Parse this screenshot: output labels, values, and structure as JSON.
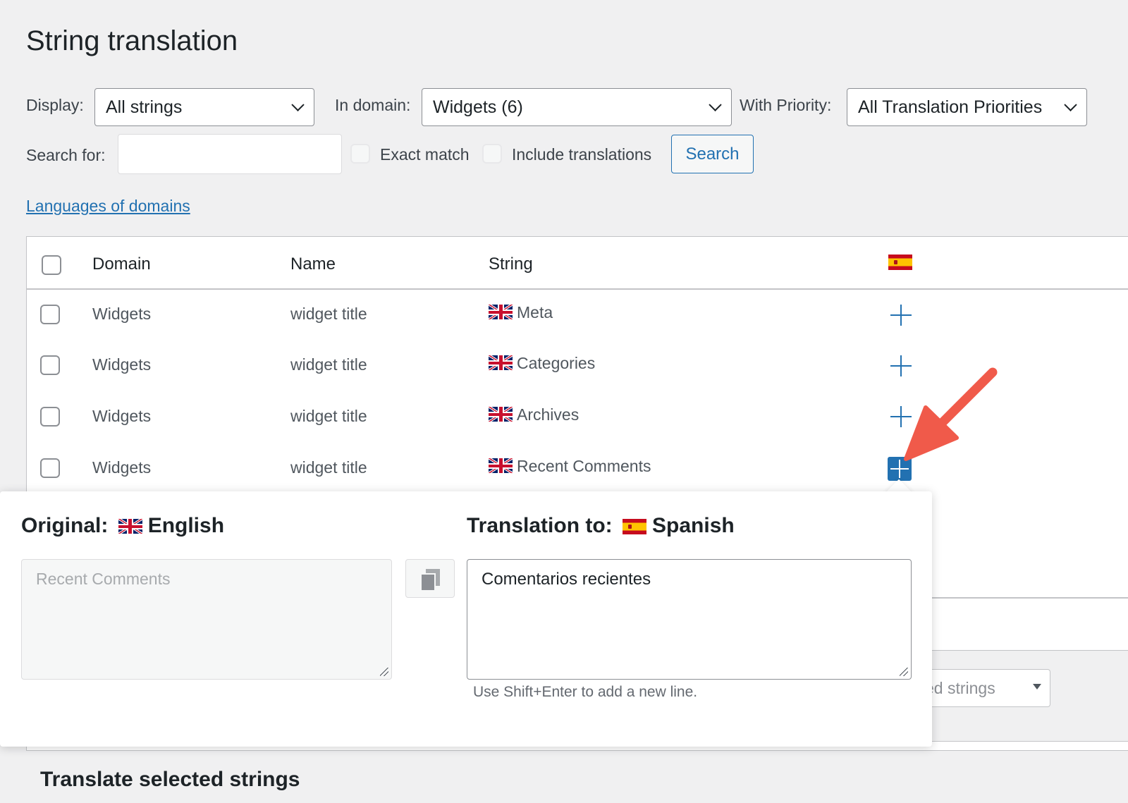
{
  "page": {
    "title": "String translation"
  },
  "filters": {
    "display_label": "Display:",
    "display_value": "All strings",
    "domain_label": "In domain:",
    "domain_value": "Widgets (6)",
    "priority_label": "With Priority:",
    "priority_value": "All Translation Priorities",
    "search_label": "Search for:",
    "search_value": "",
    "exact_match_label": "Exact match",
    "include_translations_label": "Include translations",
    "search_button": "Search"
  },
  "links": {
    "languages_of_domains": "Languages of domains"
  },
  "table": {
    "headers": {
      "domain": "Domain",
      "name": "Name",
      "string": "String",
      "language_flag": "spain-flag-icon"
    },
    "rows": [
      {
        "domain": "Widgets",
        "name": "widget title",
        "string": "Meta"
      },
      {
        "domain": "Widgets",
        "name": "widget title",
        "string": "Categories"
      },
      {
        "domain": "Widgets",
        "name": "widget title",
        "string": "Archives"
      },
      {
        "domain": "Widgets",
        "name": "widget title",
        "string": "Recent Comments"
      }
    ]
  },
  "popup": {
    "original_label": "Original:",
    "original_language": "English",
    "translation_label": "Translation to:",
    "translation_language": "Spanish",
    "original_text": "Recent Comments",
    "translation_text": "Comentarios recientes",
    "hint": "Use Shift+Enter to add a new line."
  },
  "background": {
    "bulk_select_partial": "ed strings",
    "bottom_title": "Translate selected strings"
  },
  "colors": {
    "accent": "#2271b1",
    "arrow": "#f05a4a"
  }
}
